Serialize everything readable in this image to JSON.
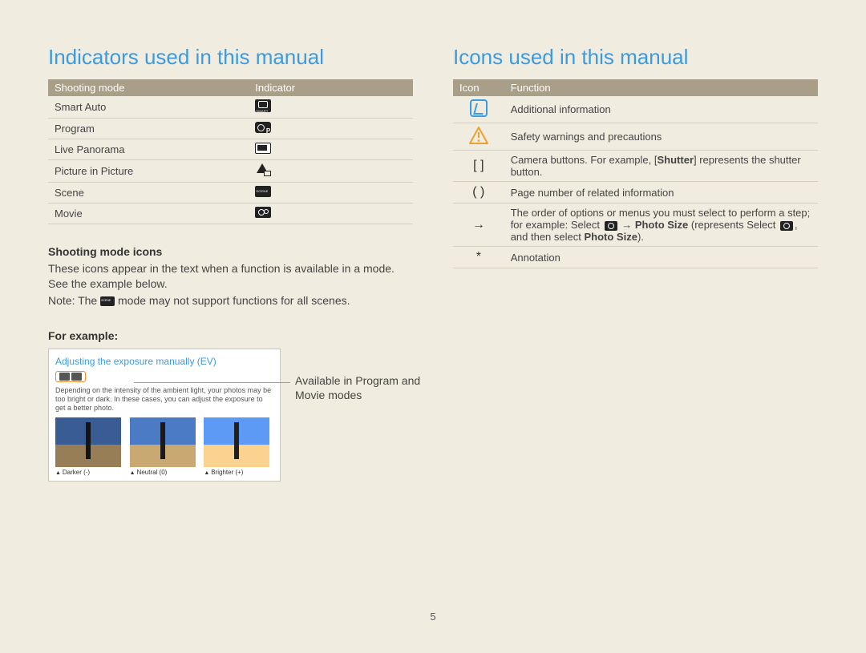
{
  "left": {
    "title": "Indicators used in this manual",
    "table": {
      "head_mode": "Shooting mode",
      "head_ind": "Indicator",
      "rows": [
        {
          "mode": "Smart Auto",
          "icon": "smart"
        },
        {
          "mode": "Program",
          "icon": "program"
        },
        {
          "mode": "Live Panorama",
          "icon": "pano"
        },
        {
          "mode": "Picture in Picture",
          "icon": "pip"
        },
        {
          "mode": "Scene",
          "icon": "scene"
        },
        {
          "mode": "Movie",
          "icon": "movie"
        }
      ]
    },
    "sub1": "Shooting mode icons",
    "p1": "These icons appear in the text when a function is available in a mode. See the example below.",
    "note_prefix": "Note: The ",
    "note_suffix": " mode may not support functions for all scenes.",
    "sub2": "For example:",
    "example": {
      "title": "Adjusting the exposure manually (EV)",
      "desc": "Depending on the intensity of the ambient light, your photos may be too bright or dark. In these cases, you can adjust the exposure to get a better photo.",
      "labels": [
        "Darker (-)",
        "Neutral (0)",
        "Brighter (+)"
      ]
    },
    "callout": "Available in Program and Movie modes"
  },
  "right": {
    "title": "Icons used in this manual",
    "table": {
      "head_icon": "Icon",
      "head_func": "Function",
      "rows": [
        {
          "icon": "info",
          "func": "Additional information"
        },
        {
          "icon": "warn",
          "func": "Safety warnings and precautions"
        },
        {
          "icon": "brackets",
          "sym": "[  ]",
          "func_pre": "Camera buttons. For example, [",
          "func_bold": "Shutter",
          "func_post": "] represents the shutter button."
        },
        {
          "icon": "paren",
          "sym": "(  )",
          "func": "Page number of related information"
        },
        {
          "icon": "arrow",
          "sym": "→",
          "func_pre": "The order of options or menus you must select to perform a step; for example: Select ",
          "cam1": true,
          "arrow": " → ",
          "bold1": "Photo Size",
          "paren_pre": " (represents Select ",
          "cam2": true,
          "paren_mid": ", and then select ",
          "bold2": "Photo Size",
          "paren_post": ")."
        },
        {
          "icon": "star",
          "sym": "*",
          "func": "Annotation"
        }
      ]
    }
  },
  "page_number": "5"
}
